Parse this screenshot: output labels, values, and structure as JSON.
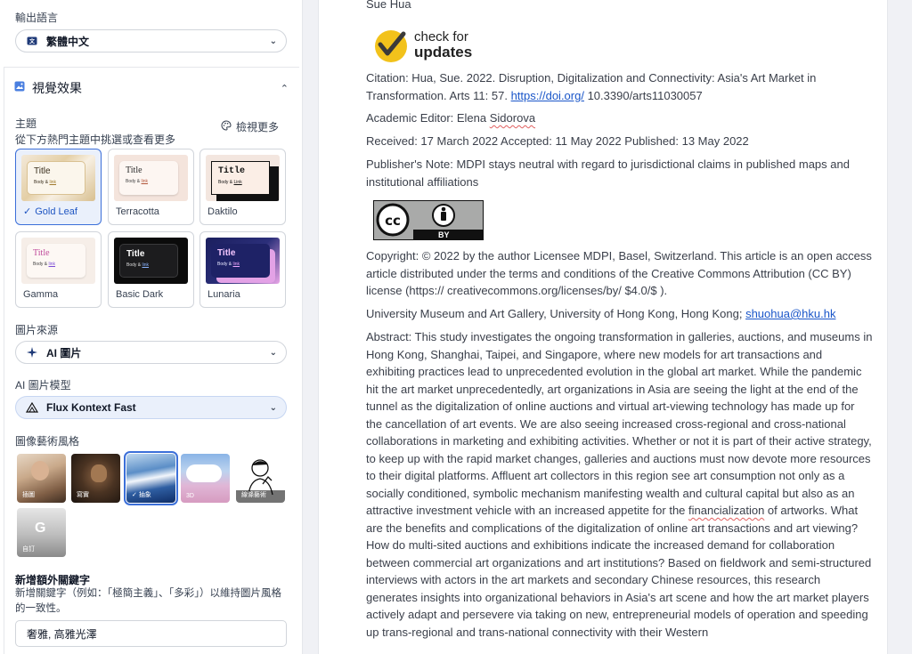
{
  "left_panel": {
    "output_language": {
      "label": "輸出語言",
      "value": "繁體中文"
    },
    "visual_effects": {
      "title": "視覺效果"
    },
    "theme": {
      "label": "主題",
      "sublabel": "從下方熱門主題中挑選或查看更多",
      "view_more": "檢視更多",
      "options": [
        {
          "name": "Gold Leaf",
          "title": "Title",
          "body": "Body & ",
          "link": "link",
          "selected": true
        },
        {
          "name": "Terracotta",
          "title": "Title",
          "body": "Body & ",
          "link": "link",
          "selected": false
        },
        {
          "name": "Daktilo",
          "title": "Title",
          "body": "Body & ",
          "link": "Link",
          "selected": false
        },
        {
          "name": "Gamma",
          "title": "Title",
          "body": "Body & ",
          "link": "link",
          "selected": false
        },
        {
          "name": "Basic Dark",
          "title": "Title",
          "body": "Body & ",
          "link": "link",
          "selected": false
        },
        {
          "name": "Lunaria",
          "title": "Title",
          "body": "Body & ",
          "link": "link",
          "selected": false
        }
      ]
    },
    "image_source": {
      "label": "圖片來源",
      "value": "AI 圖片"
    },
    "ai_model": {
      "label": "AI 圖片模型",
      "value": "Flux Kontext Fast"
    },
    "art_style": {
      "label": "圖像藝術風格",
      "options": [
        {
          "name": "插圖",
          "selected": false
        },
        {
          "name": "寫實",
          "selected": false
        },
        {
          "name": "抽象",
          "selected": true
        },
        {
          "name": "3D",
          "selected": false
        },
        {
          "name": "線條藝術",
          "selected": false
        },
        {
          "name": "自訂",
          "selected": false
        }
      ]
    },
    "extra_keywords": {
      "label": "新增額外關鍵字",
      "help": "新增關鍵字（例如：「極簡主義」、「多彩」）以維持圖片風格的一致性。",
      "value": "奢雅, 高雅光澤"
    }
  },
  "document": {
    "author": "Sue Hua",
    "check_updates_line1": "check for",
    "check_updates_line2": "updates",
    "citation_pre": "Citation: Hua, Sue. 2022. Disruption, Digitalization and Connectivity: Asia's Art Market in Transformation. Arts 11: 57. ",
    "citation_link": "https://doi.org/",
    "citation_post": " 10.3390/arts11030057",
    "editor_pre": "Academic Editor: Elena ",
    "editor_name": "Sidorova",
    "dates": "Received: 17 March 2022 Accepted: 11 May 2022 Published: 13 May 2022",
    "publisher_note": "Publisher's Note: MDPI stays neutral with regard to jurisdictional claims in published maps and institutional affiliations",
    "cc_badge": "BY",
    "copyright": "Copyright: © 2022 by the author Licensee MDPI, Basel, Switzerland. This article is an open access article distributed under the terms and conditions of the Creative Commons Attribution (CC BY) license (https:// creativecommons.org/licenses/by/ $4.0/$ ).",
    "affiliation_pre": "University Museum and Art Gallery, University of Hong Kong, Hong Kong; ",
    "affiliation_email": "shuohua@hku.hk",
    "abstract_pre": "Abstract: This study investigates the ongoing transformation in galleries, auctions, and museums in Hong Kong, Shanghai, Taipei, and Singapore, where new models for art transactions and exhibiting practices lead to unprecedented evolution in the global art market. While the pandemic hit the art market unprecedentedly, art organizations in Asia are seeing the light at the end of the tunnel as the digitalization of online auctions and virtual art-viewing technology has made up for the cancellation of art events. We are also seeing increased cross-regional and cross-national collaborations in marketing and exhibiting activities. Whether or not it is part of their active strategy, to keep up with the rapid market changes, galleries and auctions must now devote more resources to their digital platforms. Affluent art collectors in this region see art consumption not only as a socially conditioned, symbolic mechanism manifesting wealth and cultural capital but also as an attractive investment vehicle with an increased appetite for the ",
    "abstract_mid": "financialization",
    "abstract_post": " of artworks. What are the benefits and complications of the digitalization of online art transactions and art viewing? How do multi-sited auctions and exhibitions indicate the increased demand for collaboration between commercial art organizations and art institutions? Based on fieldwork and semi-structured interviews with actors in the art markets and secondary Chinese resources, this research generates insights into organizational behaviors in Asia's art scene and how the art market players actively adapt and persevere via taking on new, entrepreneurial models of operation and speeding up trans-regional and trans-national connectivity with their Western"
  },
  "colors": {
    "accent": "#3b6fd9",
    "link": "#1a56c9",
    "check_yellow": "#f2c21b"
  }
}
